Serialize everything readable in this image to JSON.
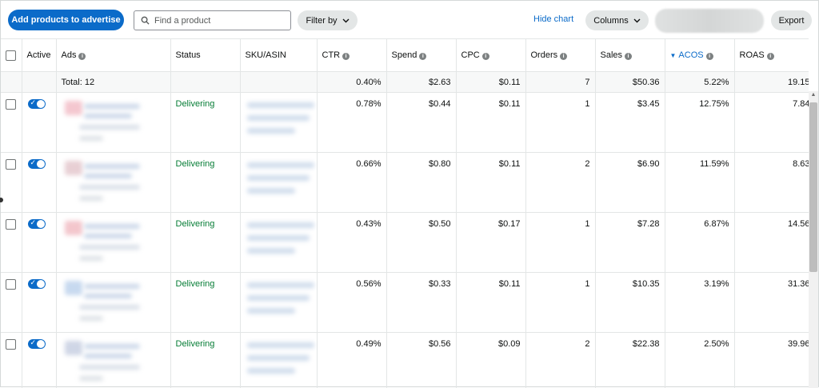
{
  "toolbar": {
    "add_products_label": "Add products to advertise",
    "search_placeholder": "Find a product",
    "filter_label": "Filter by",
    "hide_chart_label": "Hide chart",
    "columns_label": "Columns",
    "export_label": "Export"
  },
  "columns": {
    "active": "Active",
    "ads": "Ads",
    "status": "Status",
    "sku": "SKU/ASIN",
    "ctr": "CTR",
    "spend": "Spend",
    "cpc": "CPC",
    "orders": "Orders",
    "sales": "Sales",
    "acos": "ACOS",
    "roas": "ROAS"
  },
  "sort": {
    "column": "ACOS",
    "direction": "descending"
  },
  "total": {
    "label": "Total: 12",
    "ctr": "0.40%",
    "spend": "$2.63",
    "cpc": "$0.11",
    "orders": "7",
    "sales": "$50.36",
    "acos": "5.22%",
    "roas": "19.15"
  },
  "rows": [
    {
      "active": true,
      "status": "Delivering",
      "ctr": "0.78%",
      "spend": "$0.44",
      "cpc": "$0.11",
      "orders": "1",
      "sales": "$3.45",
      "acos": "12.75%",
      "roas": "7.84"
    },
    {
      "active": true,
      "status": "Delivering",
      "ctr": "0.66%",
      "spend": "$0.80",
      "cpc": "$0.11",
      "orders": "2",
      "sales": "$6.90",
      "acos": "11.59%",
      "roas": "8.63"
    },
    {
      "active": true,
      "status": "Delivering",
      "ctr": "0.43%",
      "spend": "$0.50",
      "cpc": "$0.17",
      "orders": "1",
      "sales": "$7.28",
      "acos": "6.87%",
      "roas": "14.56"
    },
    {
      "active": true,
      "status": "Delivering",
      "ctr": "0.56%",
      "spend": "$0.33",
      "cpc": "$0.11",
      "orders": "1",
      "sales": "$10.35",
      "acos": "3.19%",
      "roas": "31.36"
    },
    {
      "active": true,
      "status": "Delivering",
      "ctr": "0.49%",
      "spend": "$0.56",
      "cpc": "$0.09",
      "orders": "2",
      "sales": "$22.38",
      "acos": "2.50%",
      "roas": "39.96"
    }
  ],
  "colors": {
    "primary": "#0b6bc9",
    "status_delivering": "#067d36",
    "pill_bg": "#e3e6e6"
  },
  "icons": [
    "search-icon",
    "chevron-down-icon",
    "info-icon",
    "sort-down-icon",
    "toggle-on-icon"
  ]
}
